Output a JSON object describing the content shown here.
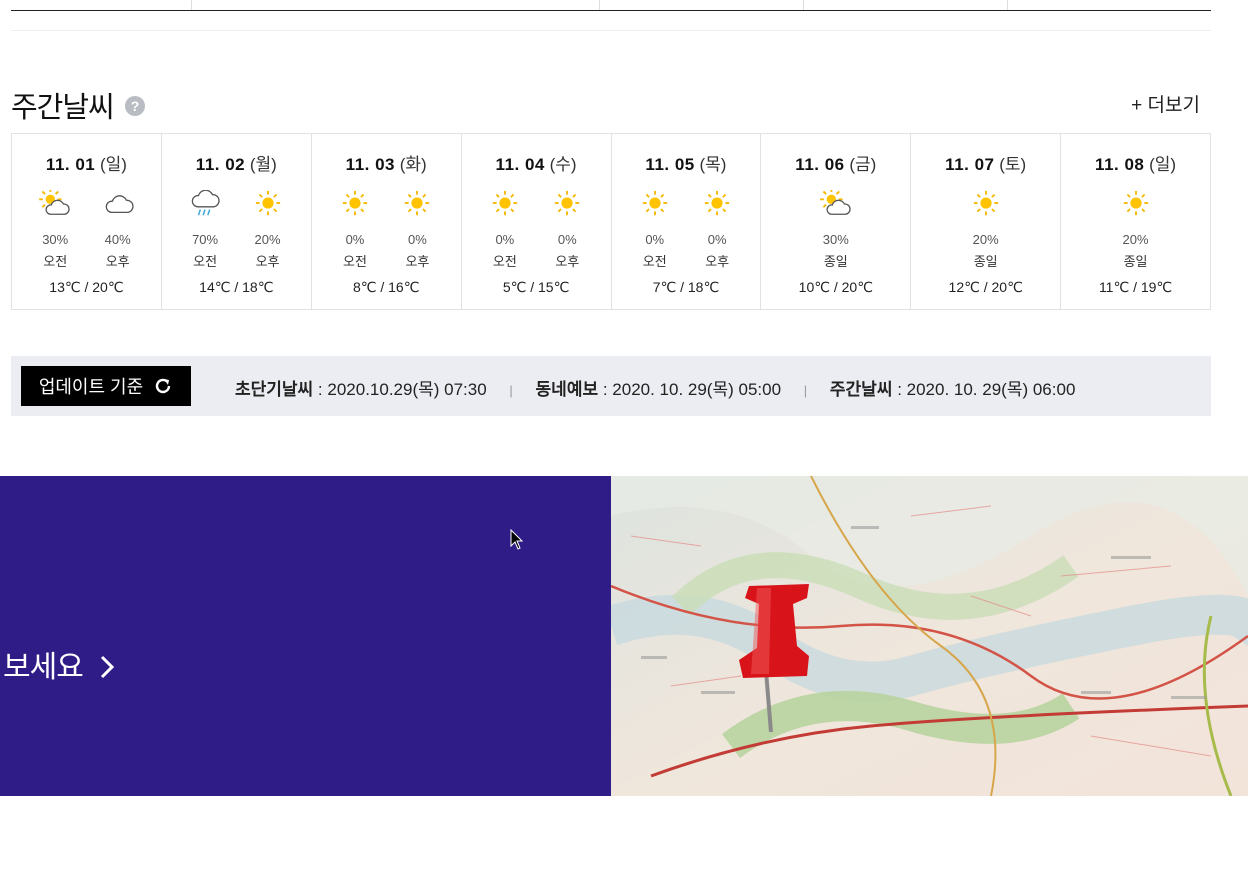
{
  "weekly": {
    "title": "주간날씨",
    "help": "?",
    "more": "+ 더보기",
    "days": [
      {
        "date": "11. 01",
        "dow": "(일)",
        "am_icon": "partly-cloudy-sun",
        "pm_icon": "cloudy",
        "am_pct": "30%",
        "pm_pct": "40%",
        "am_label": "오전",
        "pm_label": "오후",
        "temps": "13℃ / 20℃"
      },
      {
        "date": "11. 02",
        "dow": "(월)",
        "am_icon": "rain",
        "pm_icon": "sunny",
        "am_pct": "70%",
        "pm_pct": "20%",
        "am_label": "오전",
        "pm_label": "오후",
        "temps": "14℃ / 18℃"
      },
      {
        "date": "11. 03",
        "dow": "(화)",
        "am_icon": "sunny",
        "pm_icon": "sunny",
        "am_pct": "0%",
        "pm_pct": "0%",
        "am_label": "오전",
        "pm_label": "오후",
        "temps": "8℃ / 16℃"
      },
      {
        "date": "11. 04",
        "dow": "(수)",
        "am_icon": "sunny",
        "pm_icon": "sunny",
        "am_pct": "0%",
        "pm_pct": "0%",
        "am_label": "오전",
        "pm_label": "오후",
        "temps": "5℃ / 15℃"
      },
      {
        "date": "11. 05",
        "dow": "(목)",
        "am_icon": "sunny",
        "pm_icon": "sunny",
        "am_pct": "0%",
        "pm_pct": "0%",
        "am_label": "오전",
        "pm_label": "오후",
        "temps": "7℃ / 18℃"
      },
      {
        "date": "11. 06",
        "dow": "(금)",
        "all_icon": "partly-cloudy-sun",
        "all_pct": "30%",
        "all_label": "종일",
        "temps": "10℃ / 20℃"
      },
      {
        "date": "11. 07",
        "dow": "(토)",
        "all_icon": "sunny",
        "all_pct": "20%",
        "all_label": "종일",
        "temps": "12℃ / 20℃"
      },
      {
        "date": "11. 08",
        "dow": "(일)",
        "all_icon": "sunny",
        "all_pct": "20%",
        "all_label": "종일",
        "temps": "11℃ / 19℃"
      }
    ]
  },
  "update": {
    "button": "업데이트 기준",
    "items": [
      {
        "label": "초단기날씨",
        "value": " : 2020.10.29(목) 07:30"
      },
      {
        "label": "동네예보",
        "value": " : 2020. 10. 29(목) 05:00"
      },
      {
        "label": "주간날씨",
        "value": " : 2020. 10. 29(목) 06:00"
      }
    ],
    "divider": "|"
  },
  "banner": {
    "text": "보세요",
    "bg_color": "#2f1c87"
  }
}
